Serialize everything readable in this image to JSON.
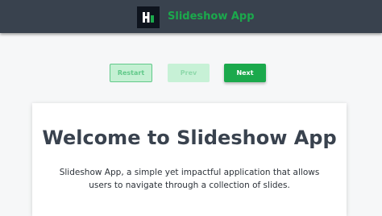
{
  "header": {
    "logo_icon": "hackerrank-logo-icon",
    "app_title": "Slideshow App",
    "background": "#39424e",
    "accent": "#1ba94c"
  },
  "controls": {
    "restart_label": "Restart",
    "prev_label": "Prev",
    "next_label": "Next"
  },
  "slide": {
    "title": "Welcome to Slideshow App",
    "text": "Slideshow App, a simple yet impactful application that allows users to navigate through a collection of slides."
  }
}
